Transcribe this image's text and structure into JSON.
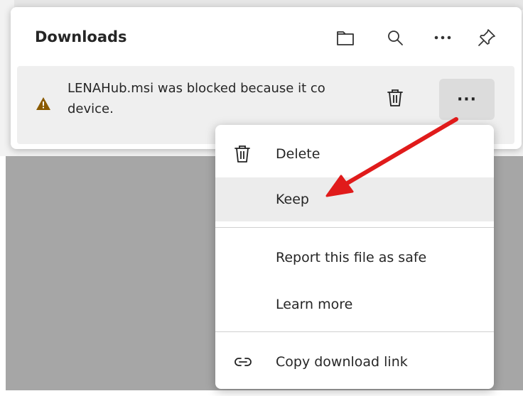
{
  "panel": {
    "title": "Downloads",
    "header_icons": [
      "folder-icon",
      "search-icon",
      "more-icon",
      "pin-icon"
    ]
  },
  "download_item": {
    "message_line1": "LENAHub.msi was blocked because it co",
    "message_line2": "device.",
    "more_label": "···"
  },
  "context_menu": {
    "items": [
      {
        "label": "Delete",
        "icon": "trash-icon"
      },
      {
        "label": "Keep",
        "icon": ""
      },
      {
        "label": "Report this file as safe",
        "icon": ""
      },
      {
        "label": "Learn more",
        "icon": ""
      },
      {
        "label": "Copy download link",
        "icon": "link-icon"
      }
    ]
  },
  "colors": {
    "warning": "#8a5a00",
    "arrow": "#e01b1b",
    "highlight": "#ececec"
  }
}
